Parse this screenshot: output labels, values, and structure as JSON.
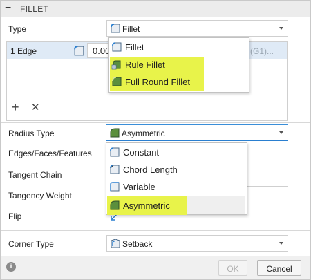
{
  "header": {
    "collapse_icon": "minus-icon",
    "title": "FILLET"
  },
  "type": {
    "label": "Type",
    "selected": "Fillet",
    "icon": "fillet-icon"
  },
  "edge_row": {
    "label": "1 Edge",
    "value_partial": "0.00",
    "suffix": "(G1)..."
  },
  "table_actions": {
    "add_icon": "plus-icon",
    "remove_icon": "x-icon"
  },
  "type_menu": {
    "items": [
      {
        "label": "Fillet",
        "icon": "fillet-icon",
        "highlighted": false
      },
      {
        "label": "Rule Fillet",
        "icon": "rule-fillet-icon",
        "highlighted": true
      },
      {
        "label": "Full Round Fillet",
        "icon": "full-round-fillet-icon",
        "highlighted": true
      }
    ]
  },
  "radius_type": {
    "label": "Radius Type",
    "selected": "Asymmetric",
    "icon": "asymmetric-icon"
  },
  "radius_menu": {
    "items": [
      {
        "label": "Constant",
        "icon": "constant-icon",
        "highlighted": false
      },
      {
        "label": "Chord Length",
        "icon": "chord-length-icon",
        "highlighted": false
      },
      {
        "label": "Variable",
        "icon": "variable-icon",
        "highlighted": false
      },
      {
        "label": "Asymmetric",
        "icon": "asymmetric-icon",
        "highlighted": true
      }
    ]
  },
  "fields": {
    "edges_faces_features": "Edges/Faces/Features",
    "tangent_chain": "Tangent Chain",
    "tangency_weight": "Tangency Weight",
    "flip": "Flip"
  },
  "corner_type": {
    "label": "Corner Type",
    "selected": "Setback",
    "icon": "setback-icon"
  },
  "footer": {
    "info_icon": "info-icon",
    "ok": "OK",
    "cancel": "Cancel"
  },
  "colors": {
    "highlight": "#e8f34a",
    "accent": "#2a7fd0",
    "selection_row": "#dfeaf6"
  }
}
